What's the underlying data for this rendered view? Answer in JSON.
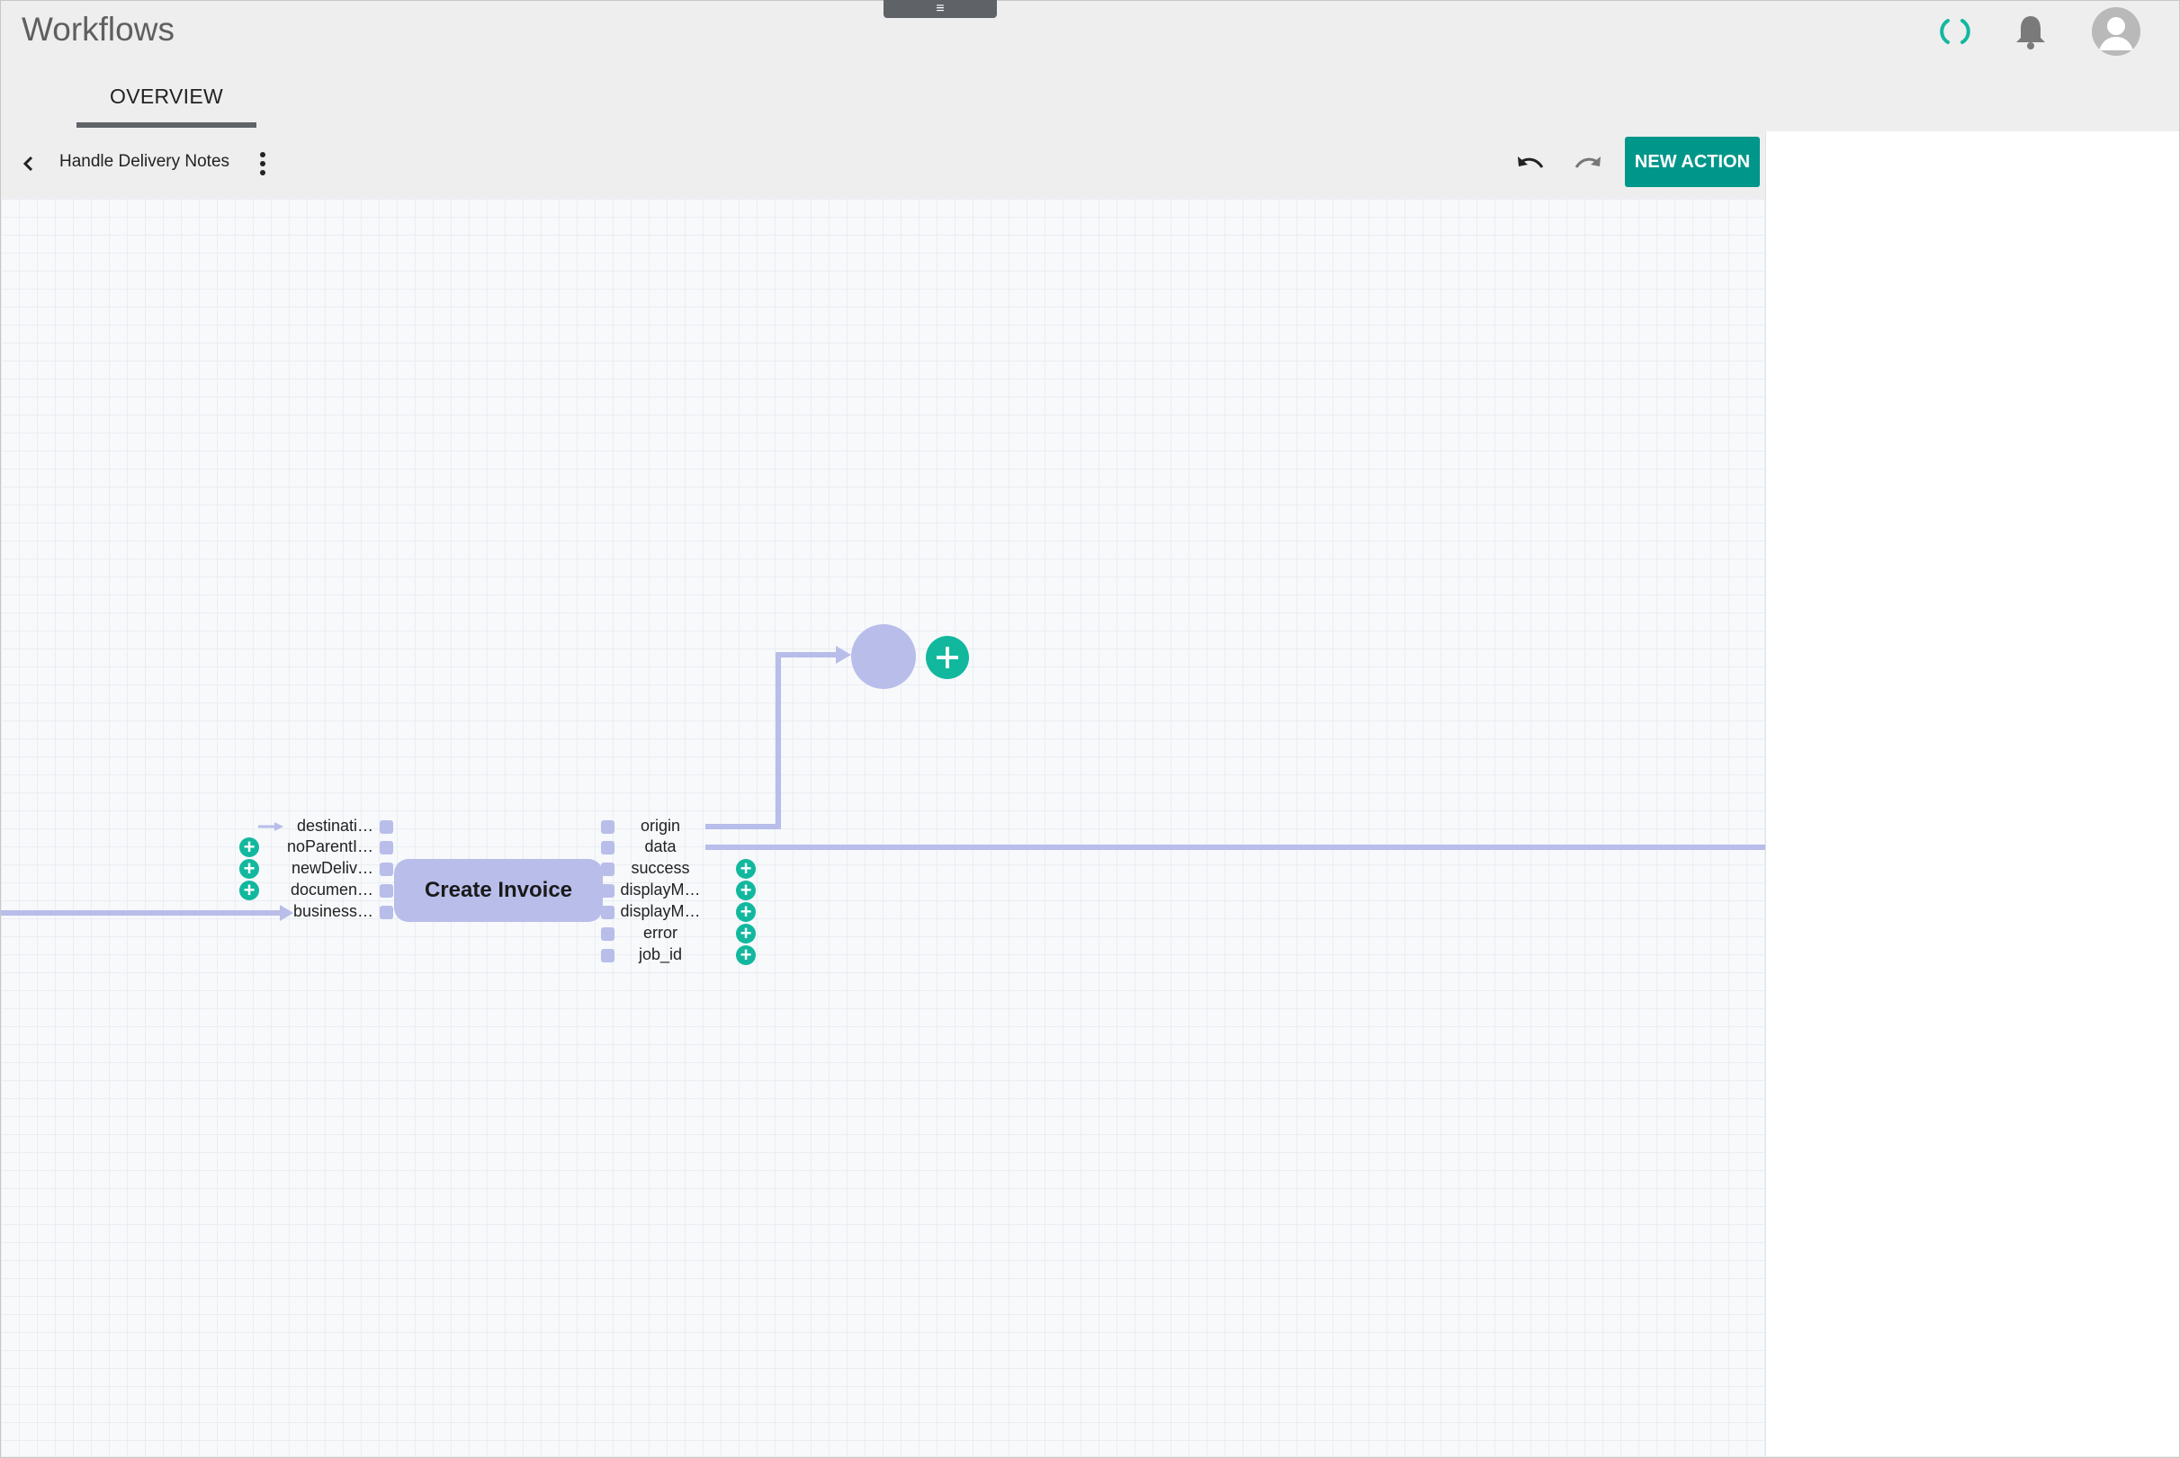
{
  "app": {
    "title": "Workflows"
  },
  "header": {
    "menu_handle_icon": "hamburger-icon",
    "sync_icon": "sync-icon",
    "notifications_icon": "bell-icon",
    "avatar_icon": "user-avatar-icon"
  },
  "tabs": [
    {
      "label": "OVERVIEW",
      "active": true
    }
  ],
  "toolbar": {
    "workflow_name": "Handle Delivery Notes",
    "new_action_label": "NEW ACTION",
    "back_icon": "chevron-left-icon",
    "more_icon": "more-vert-icon",
    "undo_icon": "undo-icon",
    "redo_icon": "redo-icon"
  },
  "node": {
    "title": "Create Invoice",
    "inputs": [
      "destinati…",
      "noParentI…",
      "newDeliv…",
      "documen…",
      "business…"
    ],
    "outputs": [
      "origin",
      "data",
      "success",
      "displayM…",
      "displayM…",
      "error",
      "job_id"
    ]
  },
  "colors": {
    "accent": "#00968a",
    "plus": "#12b89e",
    "node": "#b8bdea",
    "canvas": "#f7f9fb"
  }
}
